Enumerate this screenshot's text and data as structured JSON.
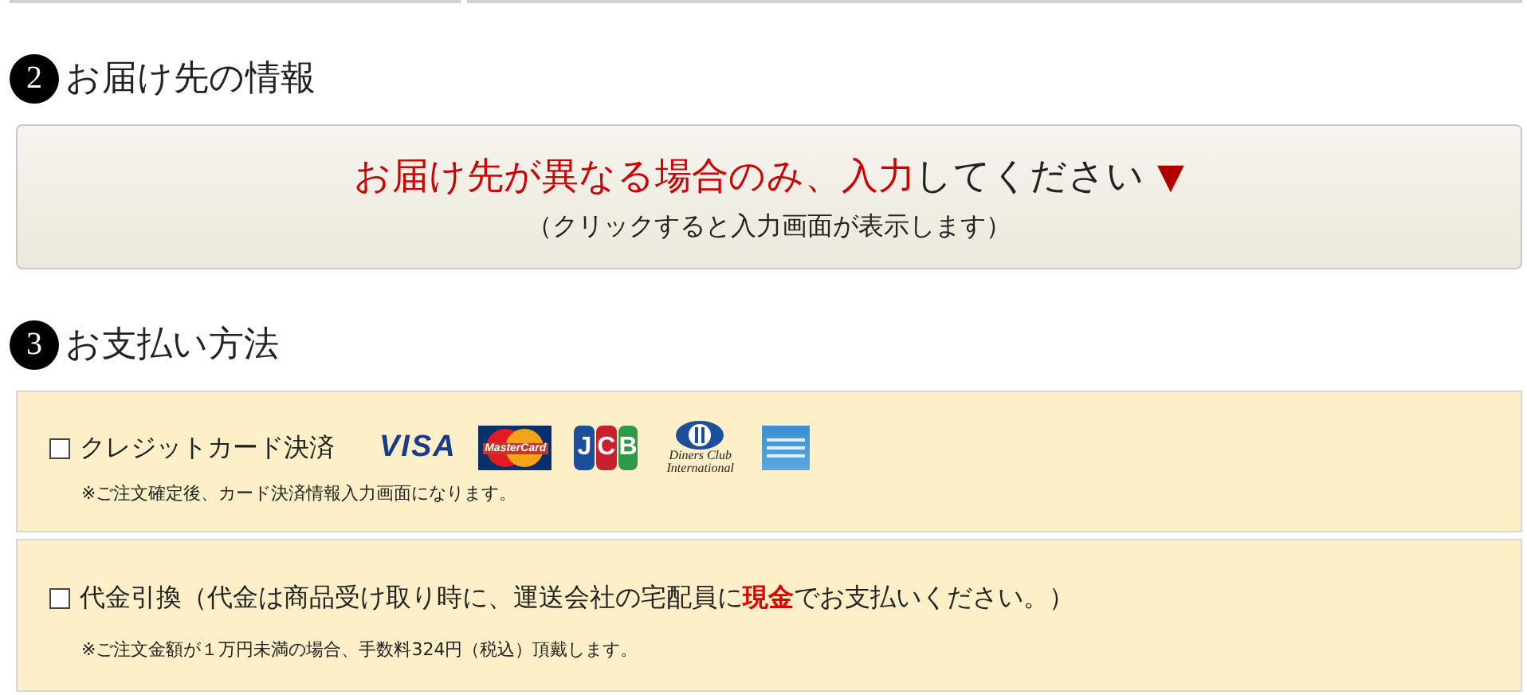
{
  "sections": [
    {
      "number": "2",
      "title": "お届け先の情報",
      "toggle": {
        "label": "**お届け先が異なる場合のみ、入力**してください",
        "arrow": "▼",
        "hint": "（クリックすると入力画面が表示します）"
      }
    },
    {
      "number": "3",
      "title": "お支払い方法",
      "options": [
        {
          "label": "クレジットカード決済",
          "checked": false,
          "note": "※ご注文確定後、カード決済情報入力画面になります。",
          "cards": [
            {
              "kind": "visa",
              "text": "VISA"
            },
            {
              "kind": "mastercard",
              "text": "MasterCard"
            },
            {
              "kind": "jcb",
              "text": "JCB"
            },
            {
              "kind": "diners",
              "text": "Diners Club International"
            },
            {
              "kind": "amex"
            }
          ]
        },
        {
          "label": "代金引換（代金は商品受け取り時に、運送会社の宅配員に**現金**でお支払いください。）",
          "checked": false,
          "note": "※ご注文金額が１万円未満の場合、手数料324円（税込）頂戴します。"
        }
      ]
    }
  ]
}
